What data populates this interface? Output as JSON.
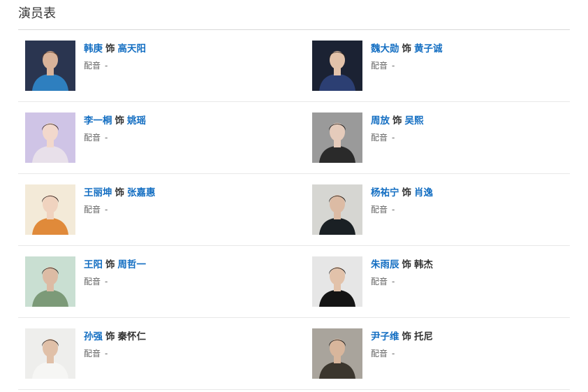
{
  "section": {
    "title": "演员表"
  },
  "cast": [
    {
      "actor": "韩庚",
      "as_word": "饰",
      "role": "高天阳",
      "role_linked": true,
      "dub_label": "配音",
      "dub_value": "-",
      "photo": {
        "bg": "#2a3550",
        "skin": "#d9b39a",
        "hair": "#5a3a26",
        "clothes": "#2e7fbf"
      }
    },
    {
      "actor": "魏大勋",
      "as_word": "饰",
      "role": "黄子诚",
      "role_linked": true,
      "dub_label": "配音",
      "dub_value": "-",
      "photo": {
        "bg": "#1b2233",
        "skin": "#e2c2aa",
        "hair": "#2a221e",
        "clothes": "#2c3f73"
      }
    },
    {
      "actor": "李一桐",
      "as_word": "饰",
      "role": "姚瑶",
      "role_linked": true,
      "dub_label": "配音",
      "dub_value": "-",
      "photo": {
        "bg": "#cfc4e6",
        "skin": "#f2d8cc",
        "hair": "#3b2a26",
        "clothes": "#e8e0ea"
      }
    },
    {
      "actor": "周放",
      "as_word": "饰",
      "role": "吴熙",
      "role_linked": true,
      "dub_label": "配音",
      "dub_value": "-",
      "photo": {
        "bg": "#9a9a9a",
        "skin": "#e5cbbb",
        "hair": "#1e1a18",
        "clothes": "#2a2a2a"
      }
    },
    {
      "actor": "王丽坤",
      "as_word": "饰",
      "role": "张嘉惠",
      "role_linked": true,
      "dub_label": "配音",
      "dub_value": "-",
      "photo": {
        "bg": "#f3ead8",
        "skin": "#f0d3bf",
        "hair": "#2a1e1a",
        "clothes": "#e08a3a"
      }
    },
    {
      "actor": "杨祐宁",
      "as_word": "饰",
      "role": "肖逸",
      "role_linked": true,
      "dub_label": "配音",
      "dub_value": "-",
      "photo": {
        "bg": "#d6d6d2",
        "skin": "#dcbba4",
        "hair": "#1f1a17",
        "clothes": "#1a2024"
      }
    },
    {
      "actor": "王阳",
      "as_word": "饰",
      "role": "周哲一",
      "role_linked": true,
      "dub_label": "配音",
      "dub_value": "-",
      "photo": {
        "bg": "#c9dfd2",
        "skin": "#dcbba4",
        "hair": "#2a221e",
        "clothes": "#7c9a78"
      }
    },
    {
      "actor": "朱雨辰",
      "as_word": "饰",
      "role": "韩杰",
      "role_linked": false,
      "dub_label": "配音",
      "dub_value": "-",
      "photo": {
        "bg": "#e6e6e6",
        "skin": "#e2c2aa",
        "hair": "#1c1816",
        "clothes": "#141414"
      }
    },
    {
      "actor": "孙强",
      "as_word": "饰",
      "role": "秦怀仁",
      "role_linked": false,
      "dub_label": "配音",
      "dub_value": "-",
      "photo": {
        "bg": "#eeeeec",
        "skin": "#e0c0a8",
        "hair": "#2a221e",
        "clothes": "#f6f6f4"
      }
    },
    {
      "actor": "尹子维",
      "as_word": "饰",
      "role": "托尼",
      "role_linked": false,
      "dub_label": "配音",
      "dub_value": "-",
      "photo": {
        "bg": "#a9a49c",
        "skin": "#d8b69c",
        "hair": "#1e1a18",
        "clothes": "#3b362e"
      }
    }
  ]
}
